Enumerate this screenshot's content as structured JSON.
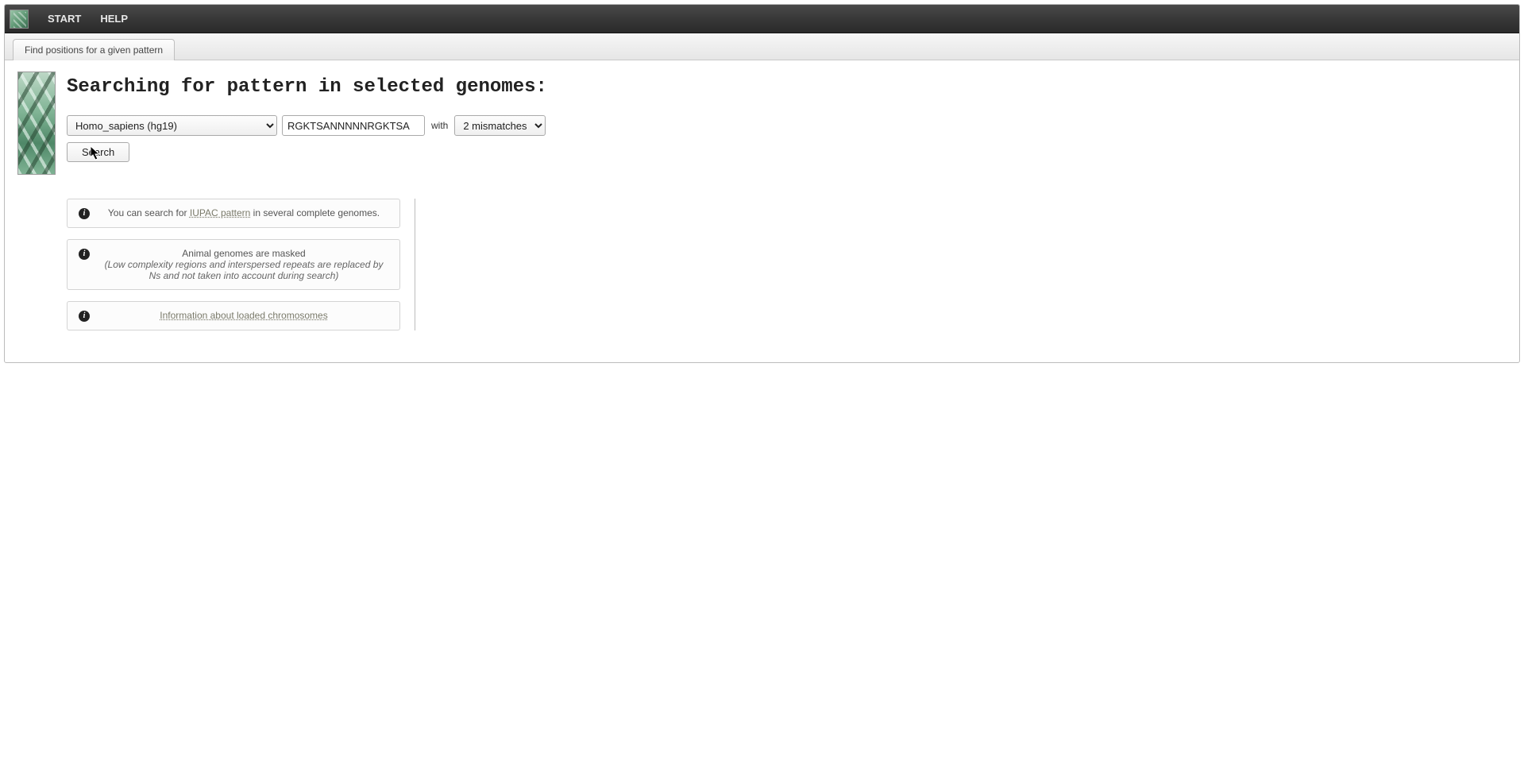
{
  "menubar": {
    "start": "START",
    "help": "HELP"
  },
  "tab": {
    "label": "Find positions for a given pattern"
  },
  "page": {
    "title": "Searching for pattern in selected genomes:"
  },
  "form": {
    "genome_selected": "Homo_sapiens (hg19)",
    "pattern_value": "RGKTSANNNNNRGKTSA",
    "with_label": "with",
    "mismatch_selected": "2 mismatches",
    "search_label": "Search"
  },
  "info": {
    "box1_prefix": "You can search for ",
    "box1_link": "IUPAC pattern",
    "box1_suffix": " in several complete genomes.",
    "box2_line1": "Animal genomes are masked",
    "box2_line2": "(Low complexity regions and interspersed repeats are replaced by Ns and not taken into account during search)",
    "box3_link": "Information about loaded chromosomes"
  }
}
